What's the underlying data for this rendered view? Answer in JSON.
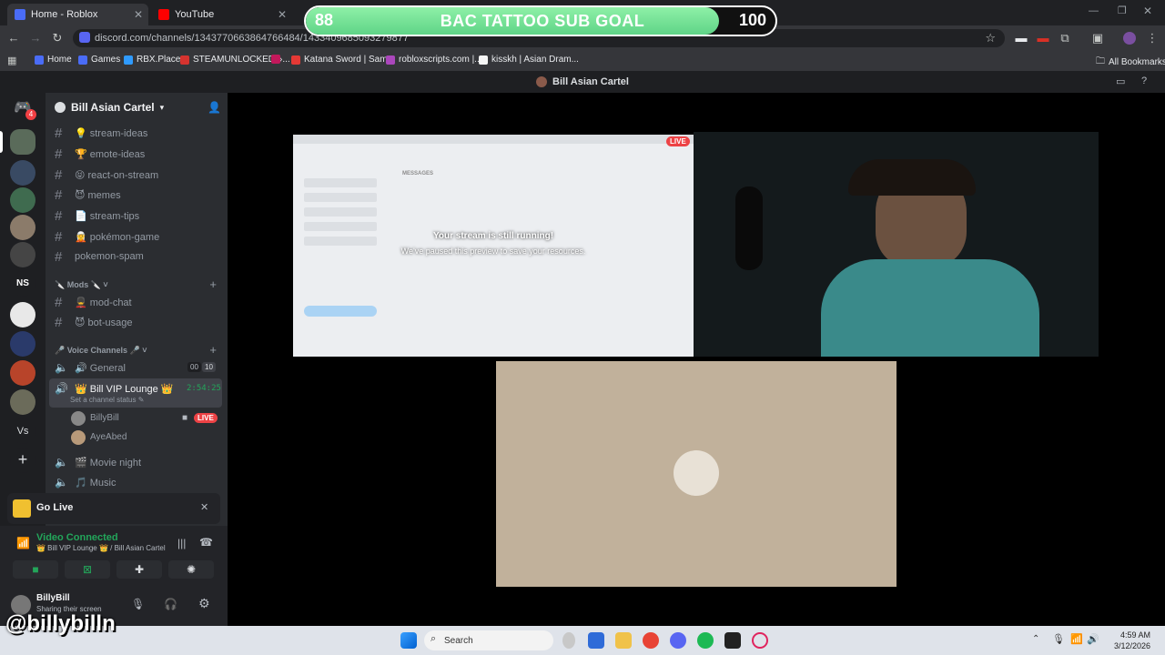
{
  "browser": {
    "tabs": [
      {
        "label": "Home - Roblox",
        "color": "#4a6cf7"
      },
      {
        "label": "YouTube",
        "color": "#ff0000"
      }
    ],
    "url": "discord.com/channels/1343770663864766484/1433409685093279877",
    "bookmarks": [
      {
        "label": "Home",
        "color": "#4a6cf7"
      },
      {
        "label": "Games",
        "color": "#4a6cf7"
      },
      {
        "label": "RBX.Place",
        "color": "#2f9bff"
      },
      {
        "label": "STEAMUNLOCKED »...",
        "color": "#d6332f"
      },
      {
        "label": "",
        "color": "#c2185b"
      },
      {
        "label": "Katana Sword | Sam...",
        "color": "#e53935"
      },
      {
        "label": "robloxscripts.com |...",
        "color": "#ab47bc"
      },
      {
        "label": "kisskh | Asian Dram...",
        "color": "#f5f5f5"
      }
    ],
    "all_bookmarks": "All Bookmarks"
  },
  "subgoal": {
    "current": "88",
    "title": "BAC TATTOO SUB GOAL",
    "max": "100",
    "progress": 0.88
  },
  "discord": {
    "window_title": "Bill Asian Cartel",
    "server_name": "Bill Asian Cartel",
    "channels": [
      {
        "label": "💡 stream-ideas"
      },
      {
        "label": "🏆 emote-ideas"
      },
      {
        "label": "😝 react-on-stream"
      },
      {
        "label": "😈 memes"
      },
      {
        "label": "📄 stream-tips"
      },
      {
        "label": "🧝 pokémon-game"
      },
      {
        "label": "pokemon-spam"
      }
    ],
    "mods_category": "🔪 Mods 🔪",
    "mod_channels": [
      {
        "label": "💂 mod-chat"
      },
      {
        "label": "😈 bot-usage"
      }
    ],
    "voice_category": "🎤 Voice Channels 🎤",
    "voice_general": {
      "label": "🔊 General",
      "count_a": "00",
      "count_b": "10"
    },
    "voice_vip": {
      "label": "👑 Bill VIP Lounge 👑",
      "timer": "2:54:25",
      "status": "Set a channel status"
    },
    "vip_users": [
      {
        "name": "BillyBill",
        "live": "LIVE"
      },
      {
        "name": "AyeAbed"
      }
    ],
    "more_voice": [
      {
        "label": "🎬 Movie night"
      },
      {
        "label": "🎵 Music"
      }
    ],
    "golive": "Go Live",
    "voice_status": "Video Connected",
    "voice_location": "👑 Bill VIP Lounge 👑 / Bill Asian Cartel",
    "user": {
      "name": "BillyBill",
      "status": "Sharing their screen"
    },
    "stream": {
      "live_badge": "LIVE",
      "paused_title": "Your stream is still running!",
      "paused_sub": "We've paused this preview to save your resources.",
      "preview_messages_header": "MESSAGES"
    },
    "notification_badge": "4"
  },
  "taskbar": {
    "search": "Search",
    "time": "4:59 AM",
    "date": "3/12/2026"
  },
  "watermark": "@billybilln"
}
